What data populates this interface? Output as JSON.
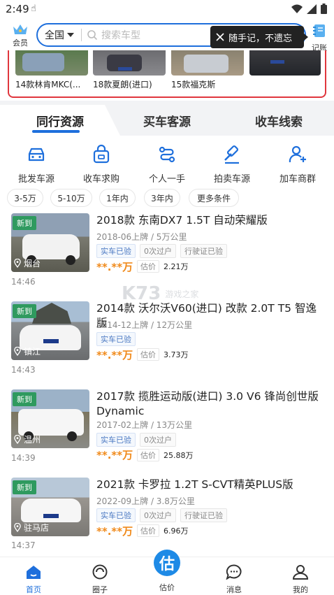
{
  "status": {
    "time": "2:49"
  },
  "header": {
    "vip_label": "会员",
    "city": "全国",
    "search_placeholder": "搜索车型",
    "tooltip": "随手记，不遗忘",
    "ledger_label": "记账"
  },
  "recent": [
    {
      "caption": "14款林肯MKC(..."
    },
    {
      "caption": "18款夏朗(进口)"
    },
    {
      "caption": "15款福克斯"
    },
    {
      "caption": ""
    }
  ],
  "tabs": [
    {
      "label": "同行资源",
      "active": true
    },
    {
      "label": "买车客源"
    },
    {
      "label": "收车线索"
    }
  ],
  "categories": [
    {
      "label": "批发车源",
      "icon": "car-front-icon"
    },
    {
      "label": "收车求购",
      "icon": "shopping-bag-icon"
    },
    {
      "label": "个人一手",
      "icon": "route-icon"
    },
    {
      "label": "拍卖车源",
      "icon": "gavel-icon"
    },
    {
      "label": "加车商群",
      "icon": "add-user-icon"
    }
  ],
  "filters": [
    "3-5万",
    "5-10万",
    "1年内",
    "3年内",
    "更多条件"
  ],
  "listings": [
    {
      "badge": "新到",
      "city": "烟台",
      "title": "2018款 东南DX7 1.5T 自动荣耀版",
      "meta": "2018-06上牌 / 5万公里",
      "tags": [
        "实车已验",
        "0次过户",
        "行驶证已验"
      ],
      "price": "**.**万",
      "est_label": "估价",
      "est_value": "2.21万",
      "time": "14:46"
    },
    {
      "badge": "新到",
      "city": "镇江",
      "title": "2014款 沃尔沃V60(进口) 改款 2.0T T5 智逸版",
      "meta": "2014-12上牌 / 12万公里",
      "tags": [
        "实车已验"
      ],
      "price": "**.**万",
      "est_label": "估价",
      "est_value": "3.73万",
      "time": "14:43"
    },
    {
      "badge": "新到",
      "city": "温州",
      "title": "2017款 揽胜运动版(进口) 3.0 V6 锋尚创世版 Dynamic",
      "meta": "2017-02上牌 / 13万公里",
      "tags": [
        "实车已验",
        "0次过户"
      ],
      "price": "**.**万",
      "est_label": "估价",
      "est_value": "25.88万",
      "time": "14:39"
    },
    {
      "badge": "新到",
      "city": "驻马店",
      "title": "2021款 卡罗拉 1.2T S-CVT精英PLUS版",
      "meta": "2022-09上牌 / 3.8万公里",
      "tags": [
        "实车已验",
        "0次过户",
        "行驶证已验"
      ],
      "price": "**.**万",
      "est_label": "估价",
      "est_value": "6.96万",
      "time": "14:37"
    }
  ],
  "watermark": {
    "logo": "K73",
    "text": "游戏之家"
  },
  "nav": [
    {
      "label": "首页",
      "active": true
    },
    {
      "label": "圈子"
    },
    {
      "label": "估价",
      "fab": "估"
    },
    {
      "label": "消息"
    },
    {
      "label": "我的"
    }
  ],
  "colors": {
    "accent": "#1e6fdc",
    "price": "#f08a1b",
    "new_badge": "#2f9a5f",
    "recent_border": "#e0363d"
  }
}
